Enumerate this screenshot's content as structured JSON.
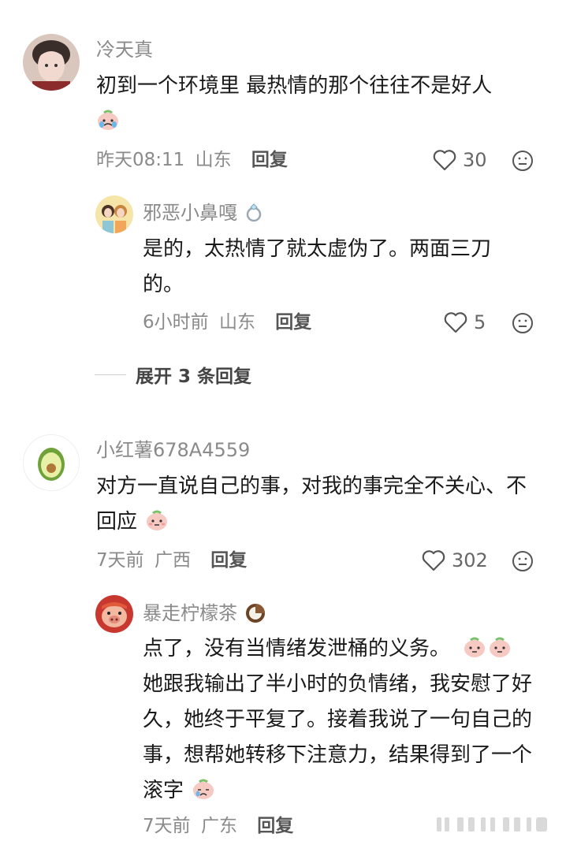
{
  "comments": [
    {
      "username": "冷天真",
      "text": "初到一个环境里 最热情的那个往往不是好人",
      "emoji": "crying-face-emoji",
      "time": "昨天08:11",
      "location": "山东",
      "reply_label": "回复",
      "likes": "30",
      "replies": [
        {
          "username": "邪恶小鼻嘎",
          "badge": "ring-icon",
          "text": "是的，太热情了就太虚伪了。两面三刀的。",
          "time": "6小时前",
          "location": "山东",
          "reply_label": "回复",
          "likes": "5"
        }
      ],
      "expand_label": "展开 3 条回复"
    },
    {
      "username": "小红薯678A4559",
      "text": "对方一直说自己的事，对我的事完全不关心、不回应",
      "emoji": "pink-face-emoji",
      "time": "7天前",
      "location": "广西",
      "reply_label": "回复",
      "likes": "302",
      "replies": [
        {
          "username": "暴走柠檬茶",
          "badge": "coconut-icon",
          "text1": "点了，没有当情绪发泄桶的义务。",
          "text2": "她跟我输出了半小时的负情绪，我安慰了好久，她终于平复了。接着我说了一句自己的事，想帮她转移下注意力，结果得到了一个滚字",
          "time": "7天前",
          "location": "广东",
          "reply_label": "回复"
        }
      ]
    }
  ],
  "colors": {
    "meta_gray": "#8a8a8a",
    "text": "#1a1a1a"
  }
}
